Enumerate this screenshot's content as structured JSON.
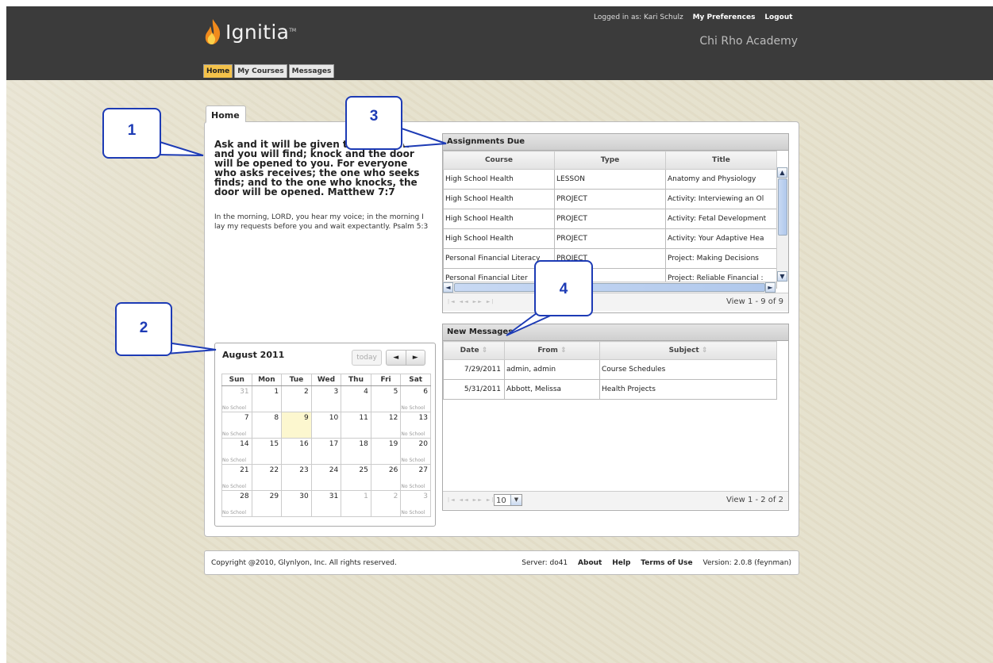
{
  "brand": {
    "name": "Ignitia",
    "tm": "TM"
  },
  "header": {
    "logged_in_text": "Logged in as: Kari Schulz",
    "preferences_label": "My Preferences",
    "logout_label": "Logout",
    "school": "Chi Rho Academy"
  },
  "nav": {
    "tabs": [
      "Home",
      "My Courses",
      "Messages"
    ],
    "active": "Home"
  },
  "page_tab": "Home",
  "verses": {
    "main": "Ask and it will be given to you; seek and you will find; knock and the door will be opened to you. For everyone who asks receives; the one who seeks finds; and to the one who knocks, the door will be opened. Matthew 7:7",
    "secondary": "In the morning, LORD, you hear my voice; in the morning I lay my requests before you and wait expectantly. Psalm 5:3"
  },
  "assignments": {
    "title": "Assignments Due",
    "columns": [
      "Course",
      "Type",
      "Title"
    ],
    "rows": [
      [
        "High School Health",
        "LESSON",
        "Anatomy and Physiology"
      ],
      [
        "High School Health",
        "PROJECT",
        "Activity: Interviewing an Ol"
      ],
      [
        "High School Health",
        "PROJECT",
        "Activity: Fetal Development"
      ],
      [
        "High School Health",
        "PROJECT",
        "Activity: Your Adaptive Hea"
      ],
      [
        "Personal Financial Literacy",
        "PROJECT",
        "Project: Making Decisions"
      ],
      [
        "Personal Financial Liter",
        "",
        "Project:  Reliable Financial :"
      ]
    ],
    "pager_text": "View 1 - 9 of 9"
  },
  "messages": {
    "title": "New Messages",
    "columns": [
      "Date",
      "From",
      "Subject"
    ],
    "rows": [
      [
        "7/29/2011",
        "admin, admin",
        "Course Schedules"
      ],
      [
        "5/31/2011",
        "Abbott, Melissa",
        "Health Projects"
      ]
    ],
    "page_size": "10",
    "pager_text": "View 1 - 2 of 2"
  },
  "calendar": {
    "month": "August 2011",
    "today_label": "today",
    "prev_label": "◄",
    "next_label": "►",
    "weekdays": [
      "Sun",
      "Mon",
      "Tue",
      "Wed",
      "Thu",
      "Fri",
      "Sat"
    ],
    "no_school_label": "No School",
    "weeks": [
      [
        "31",
        "1",
        "2",
        "3",
        "4",
        "5",
        "6"
      ],
      [
        "7",
        "8",
        "9",
        "10",
        "11",
        "12",
        "13"
      ],
      [
        "14",
        "15",
        "16",
        "17",
        "18",
        "19",
        "20"
      ],
      [
        "21",
        "22",
        "23",
        "24",
        "25",
        "26",
        "27"
      ],
      [
        "28",
        "29",
        "30",
        "31",
        "1",
        "2",
        "3"
      ]
    ],
    "today_date": "9"
  },
  "footer": {
    "copyright": "Copyright @2010, Glynlyon, Inc. All rights reserved.",
    "server": "Server: do41",
    "about": "About",
    "help": "Help",
    "terms": "Terms of Use",
    "version": "Version: 2.0.8 (feynman)"
  },
  "callouts": [
    "1",
    "2",
    "3",
    "4"
  ],
  "colors": {
    "header_bg": "#3b3b3b",
    "active_tab": "#f4c24a",
    "callout_blue": "#1d3bb5",
    "today_cell": "#fcf7cf"
  }
}
